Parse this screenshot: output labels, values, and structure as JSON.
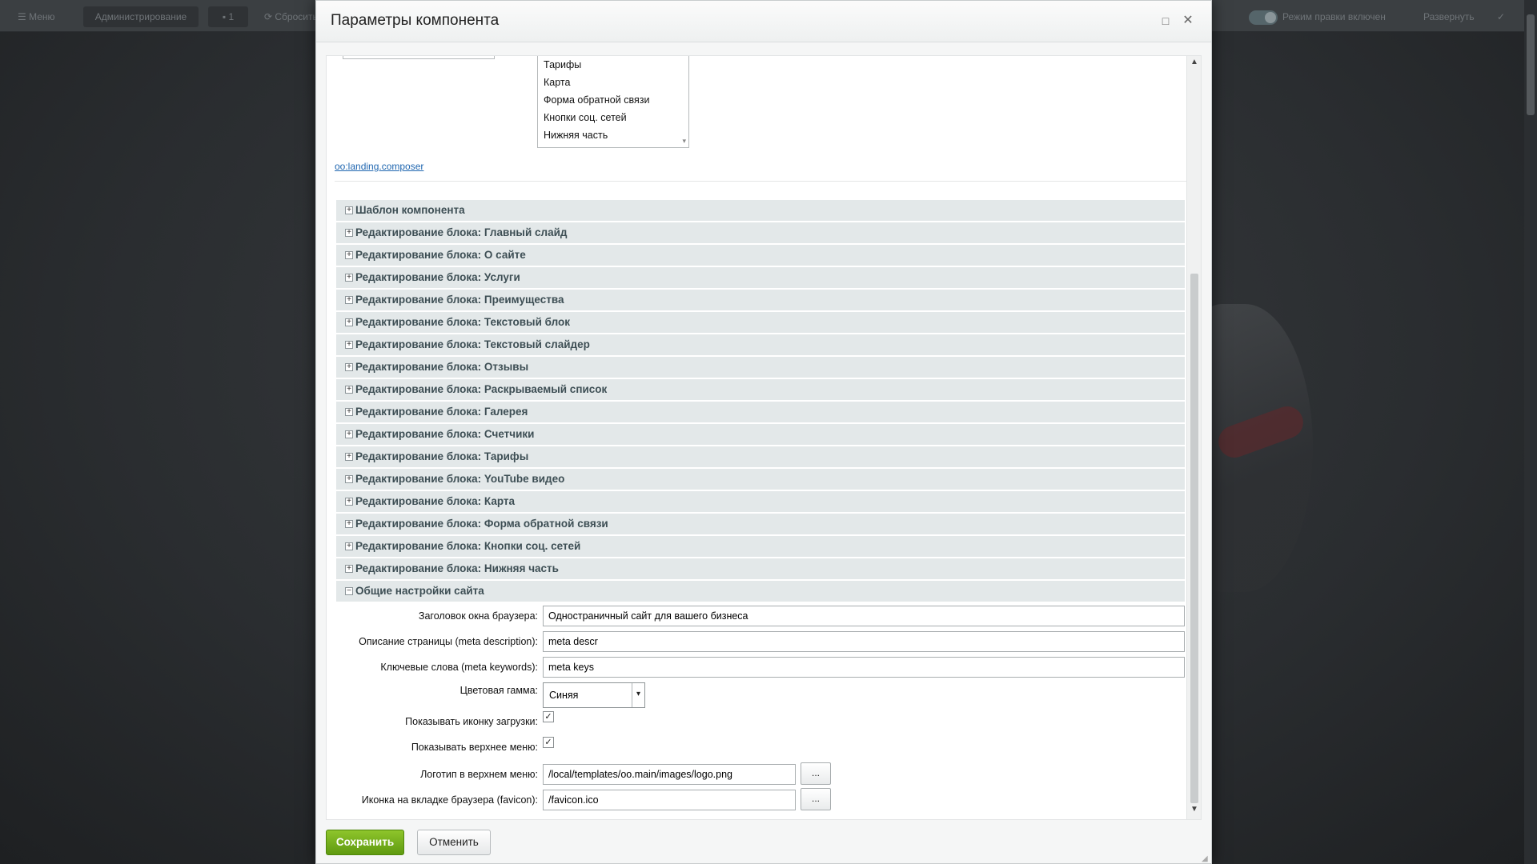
{
  "topbar": {
    "menu": "☰  Меню",
    "admin": "Администрирование",
    "notifications": "1",
    "reset": "⟳  Сбросить кеш",
    "edit_mode": "Режим правки включен",
    "expand": "Развернуть"
  },
  "dialog": {
    "title": "Параметры компонента",
    "listbox_items": [
      "Тарифы",
      "Карта",
      "Форма обратной связи",
      "Кнопки соц. сетей",
      "Нижняя часть"
    ],
    "component_link": "oo:landing.composer",
    "groups": [
      {
        "label": "Шаблон компонента",
        "expanded": false
      },
      {
        "label": "Редактирование блока: Главный слайд",
        "expanded": false
      },
      {
        "label": "Редактирование блока: О сайте",
        "expanded": false
      },
      {
        "label": "Редактирование блока: Услуги",
        "expanded": false
      },
      {
        "label": "Редактирование блока: Преимущества",
        "expanded": false
      },
      {
        "label": "Редактирование блока: Текстовый блок",
        "expanded": false
      },
      {
        "label": "Редактирование блока: Текстовый слайдер",
        "expanded": false
      },
      {
        "label": "Редактирование блока: Отзывы",
        "expanded": false
      },
      {
        "label": "Редактирование блока: Раскрываемый список",
        "expanded": false
      },
      {
        "label": "Редактирование блока: Галерея",
        "expanded": false
      },
      {
        "label": "Редактирование блока: Счетчики",
        "expanded": false
      },
      {
        "label": "Редактирование блока: Тарифы",
        "expanded": false
      },
      {
        "label": "Редактирование блока: YouTube видео",
        "expanded": false
      },
      {
        "label": "Редактирование блока: Карта",
        "expanded": false
      },
      {
        "label": "Редактирование блока: Форма обратной связи",
        "expanded": false
      },
      {
        "label": "Редактирование блока: Кнопки соц. сетей",
        "expanded": false
      },
      {
        "label": "Редактирование блока: Нижняя часть",
        "expanded": false
      },
      {
        "label": "Общие настройки сайта",
        "expanded": true
      }
    ],
    "fields": {
      "browser_title": {
        "label": "Заголовок окна браузера:",
        "value": "Одностраничный сайт для вашего бизнеса"
      },
      "meta_description": {
        "label": "Описание страницы (meta description):",
        "value": "meta descr"
      },
      "meta_keywords": {
        "label": "Ключевые слова (meta keywords):",
        "value": "meta keys"
      },
      "color_scheme": {
        "label": "Цветовая гамма:",
        "value": "Синяя"
      },
      "show_loader": {
        "label": "Показывать иконку загрузки:",
        "checked": true
      },
      "show_top_menu": {
        "label": "Показывать верхнее меню:",
        "checked": true
      },
      "logo": {
        "label": "Логотип в верхнем меню:",
        "value": "/local/templates/oo.main/images/logo.png",
        "browse": "..."
      },
      "favicon": {
        "label": "Иконка на вкладке браузера (favicon):",
        "value": "/favicon.ico",
        "browse": "..."
      }
    },
    "buttons": {
      "save": "Сохранить",
      "cancel": "Отменить"
    }
  }
}
